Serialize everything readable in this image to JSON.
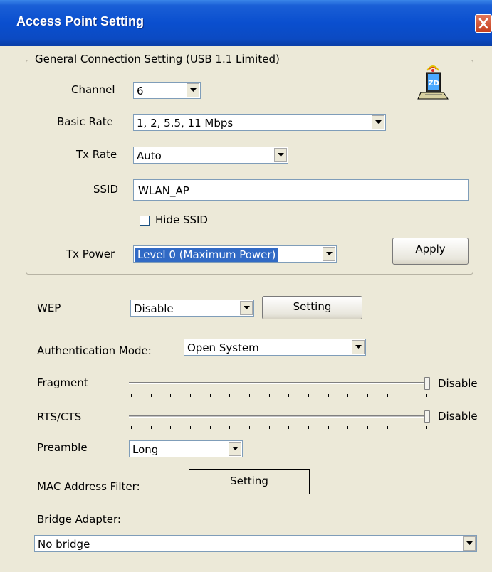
{
  "window": {
    "title": "Access Point Setting"
  },
  "general": {
    "legend": "General Connection Setting (USB 1.1 Limited)",
    "channel": {
      "label": "Channel",
      "value": "6"
    },
    "basic_rate": {
      "label": "Basic Rate",
      "value": "1, 2, 5.5, 11 Mbps"
    },
    "tx_rate": {
      "label": "Tx Rate",
      "value": "Auto"
    },
    "ssid": {
      "label": "SSID",
      "value": "WLAN_AP"
    },
    "hide_ssid": {
      "label": "Hide SSID",
      "checked": false
    },
    "tx_power": {
      "label": "Tx Power",
      "value": "Level 0 (Maximum Power)"
    },
    "apply_label": "Apply",
    "icon": "wireless-router-icon"
  },
  "wep": {
    "label": "WEP",
    "value": "Disable",
    "setting_label": "Setting"
  },
  "auth": {
    "label": "Authentication Mode:",
    "value": "Open System"
  },
  "fragment": {
    "label": "Fragment",
    "value_label": "Disable",
    "position": 1.0
  },
  "rts": {
    "label": "RTS/CTS",
    "value_label": "Disable",
    "position": 1.0
  },
  "preamble": {
    "label": "Preamble",
    "value": "Long"
  },
  "mac_filter": {
    "label": "MAC Address Filter:",
    "setting_label": "Setting"
  },
  "bridge": {
    "label": "Bridge Adapter:",
    "value": "No bridge"
  },
  "colors": {
    "titlebar": "#0a4fcf",
    "selection": "#316ac5",
    "dialog_bg": "#ece9d8"
  }
}
